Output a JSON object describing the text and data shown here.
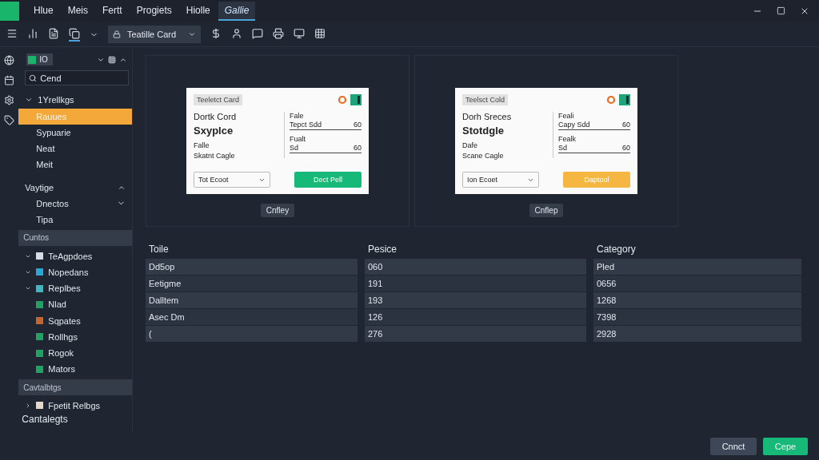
{
  "menu": [
    {
      "label": "Hlue",
      "selected": false
    },
    {
      "label": "Meis",
      "selected": false
    },
    {
      "label": "Fertt",
      "selected": false
    },
    {
      "label": "Progiets",
      "selected": false
    },
    {
      "label": "Hiolle",
      "selected": false
    },
    {
      "label": "Gallie",
      "selected": true
    }
  ],
  "toolbar": {
    "tools": [
      {
        "selected": false
      },
      {
        "selected": true
      }
    ],
    "dropdown": "Teatille Card"
  },
  "sidebar": {
    "tag": "IO",
    "search": "Cend",
    "group": {
      "label": "1Yrellkgs",
      "expanded": true,
      "children": [
        {
          "label": "Rauues",
          "selected": true
        },
        {
          "label": "Sypuarie",
          "selected": false
        },
        {
          "label": "Neat",
          "selected": false
        },
        {
          "label": "Meit",
          "selected": false
        }
      ]
    },
    "section": {
      "label": "Vaytige",
      "expanded": true,
      "children": [
        {
          "label": "Dnectos",
          "expanded": false
        },
        {
          "label": "Tipa"
        }
      ]
    },
    "headers": [
      "Cuntos",
      "Cavtalbtgs"
    ],
    "tree": [
      {
        "label": "TeAgpdoes",
        "color": "#d8dde4"
      },
      {
        "label": "Nopedans",
        "color": "#2aa7d8"
      },
      {
        "label": "Replbes",
        "color": "#3fb6c4",
        "children": [
          {
            "label": "Nlad",
            "color": "#1fa363"
          },
          {
            "label": "Sqpates",
            "color": "#c4652a"
          },
          {
            "label": "Rollhgs",
            "color": "#1fa363"
          },
          {
            "label": "Rogok",
            "color": "#1fa363"
          },
          {
            "label": "Mators",
            "color": "#1fa363"
          }
        ]
      }
    ],
    "tree2": [
      {
        "label": "Fpetit Relbgs",
        "color": "#e8d6c8"
      }
    ],
    "footer": "Cantalegts"
  },
  "cards": [
    {
      "tag": "Teeletct Card",
      "title": "Dortk Cord",
      "subtitle": "Sxyplce",
      "label": "Falle",
      "note": "Skatnt Cagle",
      "fields": [
        {
          "label": "Fale",
          "value": "Tepct Sdd",
          "num": "60"
        },
        {
          "label": "Fualt",
          "value": "Sd",
          "num": "60"
        }
      ],
      "select": "Tot Ecoot",
      "action": "Dect Pell",
      "color": "#17b978",
      "caption": "Cnfley"
    },
    {
      "tag": "Teelsct Cold",
      "title": "Dorh Sreces",
      "subtitle": "Stotdgle",
      "label": "Dafe",
      "note": "Scane Cagle",
      "fields": [
        {
          "label": "Feali",
          "value": "Capy Sdd",
          "num": "60"
        },
        {
          "label": "Fealk",
          "value": "Sd",
          "num": "60"
        }
      ],
      "select": "Ion Ecoet",
      "action": "Daptool",
      "color": "#f5b642",
      "caption": "Cnflep"
    }
  ],
  "table": {
    "columns": [
      "Toile",
      "Pesice",
      "Category"
    ],
    "rows": [
      [
        "Dd5op",
        "060",
        "Pled"
      ],
      [
        "Eetigme",
        "191",
        "0656"
      ],
      [
        "Dalltem",
        "193",
        "1268"
      ],
      [
        "Asec Dm",
        "126",
        "7398"
      ],
      [
        "(",
        "276",
        "2928"
      ]
    ]
  },
  "buttons": {
    "cancel": "Cnnct",
    "save": "Cepe"
  }
}
